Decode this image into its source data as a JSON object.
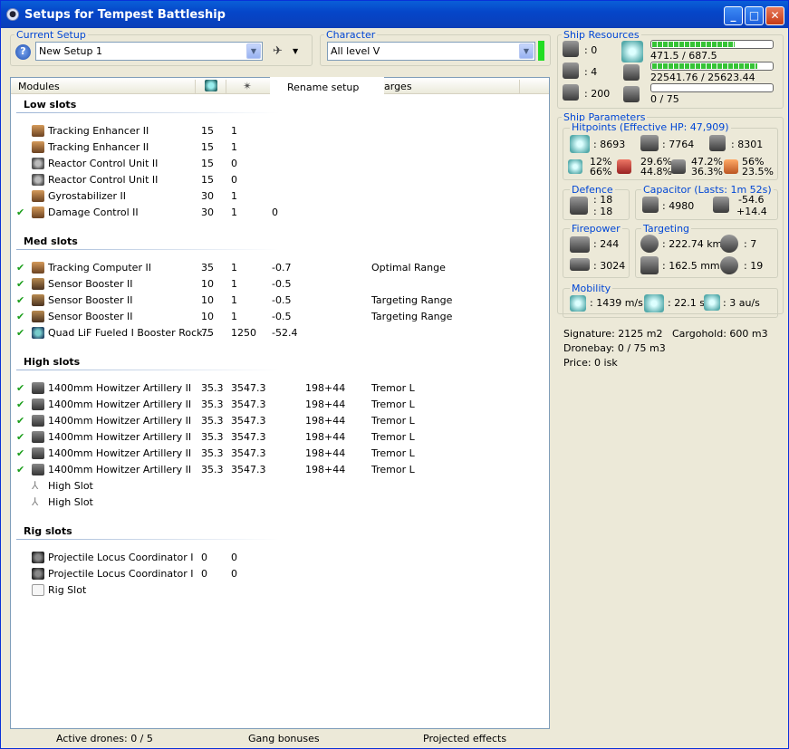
{
  "window": {
    "title": "Setups for Tempest Battleship",
    "icon": "eve-icon"
  },
  "current_setup": {
    "label": "Current Setup",
    "value": "New Setup 1"
  },
  "character": {
    "label": "Character",
    "value": "All level V",
    "status_color": "#22dd22"
  },
  "popup": {
    "rename": "Rename setup"
  },
  "columns": {
    "modules": "Modules",
    "charges": "arges"
  },
  "sections": {
    "low": "Low slots",
    "med": "Med slots",
    "high": "High slots",
    "rig": "Rig slots"
  },
  "low_slots": [
    {
      "check": "",
      "icon": "hardwiring",
      "name": "Tracking Enhancer II",
      "cpu": "15",
      "pg": "1",
      "c3": "",
      "c4": "",
      "c5": ""
    },
    {
      "check": "",
      "icon": "hardwiring",
      "name": "Tracking Enhancer II",
      "cpu": "15",
      "pg": "1",
      "c3": "",
      "c4": "",
      "c5": ""
    },
    {
      "check": "",
      "icon": "cpu",
      "name": "Reactor Control Unit II",
      "cpu": "15",
      "pg": "0",
      "c3": "",
      "c4": "",
      "c5": ""
    },
    {
      "check": "",
      "icon": "cpu",
      "name": "Reactor Control Unit II",
      "cpu": "15",
      "pg": "0",
      "c3": "",
      "c4": "",
      "c5": ""
    },
    {
      "check": "",
      "icon": "hardwiring",
      "name": "Gyrostabilizer II",
      "cpu": "30",
      "pg": "1",
      "c3": "",
      "c4": "",
      "c5": ""
    },
    {
      "check": "✔",
      "icon": "damage",
      "name": "Damage Control II",
      "cpu": "30",
      "pg": "1",
      "c3": "0",
      "c4": "",
      "c5": ""
    }
  ],
  "med_slots": [
    {
      "check": "✔",
      "icon": "hardwiring",
      "name": "Tracking Computer II",
      "cpu": "35",
      "pg": "1",
      "c3": "-0.7",
      "c4": "",
      "c5": "Optimal Range"
    },
    {
      "check": "✔",
      "icon": "sensor",
      "name": "Sensor Booster II",
      "cpu": "10",
      "pg": "1",
      "c3": "-0.5",
      "c4": "",
      "c5": ""
    },
    {
      "check": "✔",
      "icon": "sensor",
      "name": "Sensor Booster II",
      "cpu": "10",
      "pg": "1",
      "c3": "-0.5",
      "c4": "",
      "c5": "Targeting Range"
    },
    {
      "check": "✔",
      "icon": "sensor",
      "name": "Sensor Booster II",
      "cpu": "10",
      "pg": "1",
      "c3": "-0.5",
      "c4": "",
      "c5": "Targeting Range"
    },
    {
      "check": "✔",
      "icon": "booster",
      "name": "Quad LiF Fueled I Booster Rock...",
      "cpu": "75",
      "pg": "1250",
      "c3": "-52.4",
      "c4": "",
      "c5": ""
    }
  ],
  "high_slots": [
    {
      "check": "✔",
      "icon": "gun",
      "name": "1400mm Howitzer Artillery II",
      "cpu": "35.3",
      "pg": "3547.3",
      "c3": "",
      "c4": "198+44",
      "c5": "Tremor L"
    },
    {
      "check": "✔",
      "icon": "gun",
      "name": "1400mm Howitzer Artillery II",
      "cpu": "35.3",
      "pg": "3547.3",
      "c3": "",
      "c4": "198+44",
      "c5": "Tremor L"
    },
    {
      "check": "✔",
      "icon": "gun",
      "name": "1400mm Howitzer Artillery II",
      "cpu": "35.3",
      "pg": "3547.3",
      "c3": "",
      "c4": "198+44",
      "c5": "Tremor L"
    },
    {
      "check": "✔",
      "icon": "gun",
      "name": "1400mm Howitzer Artillery II",
      "cpu": "35.3",
      "pg": "3547.3",
      "c3": "",
      "c4": "198+44",
      "c5": "Tremor L"
    },
    {
      "check": "✔",
      "icon": "gun",
      "name": "1400mm Howitzer Artillery II",
      "cpu": "35.3",
      "pg": "3547.3",
      "c3": "",
      "c4": "198+44",
      "c5": "Tremor L"
    },
    {
      "check": "✔",
      "icon": "gun",
      "name": "1400mm Howitzer Artillery II",
      "cpu": "35.3",
      "pg": "3547.3",
      "c3": "",
      "c4": "198+44",
      "c5": "Tremor L"
    },
    {
      "check": "",
      "icon": "slot",
      "name": "High Slot",
      "cpu": "",
      "pg": "",
      "c3": "",
      "c4": "",
      "c5": ""
    },
    {
      "check": "",
      "icon": "slot",
      "name": "High Slot",
      "cpu": "",
      "pg": "",
      "c3": "",
      "c4": "",
      "c5": ""
    }
  ],
  "rig_slots": [
    {
      "check": "",
      "icon": "rig",
      "name": "Projectile Locus Coordinator I",
      "cpu": "0",
      "pg": "0",
      "c3": "",
      "c4": "",
      "c5": ""
    },
    {
      "check": "",
      "icon": "rig",
      "name": "Projectile Locus Coordinator I",
      "cpu": "0",
      "pg": "0",
      "c3": "",
      "c4": "",
      "c5": ""
    },
    {
      "check": "",
      "icon": "rigslot",
      "name": "Rig Slot",
      "cpu": "",
      "pg": "",
      "c3": "",
      "c4": "",
      "c5": ""
    }
  ],
  "status": {
    "drones": "Active drones: 0 / 5",
    "gang": "Gang bonuses",
    "projected": "Projected effects"
  },
  "resources": {
    "label": "Ship Resources",
    "turrets": ": 0",
    "launchers": ": 4",
    "calibration": ": 200",
    "cpu": "471.5 / 687.5",
    "cpu_fill": 0.686,
    "pg": "22541.76 / 25623.44",
    "pg_fill": 0.88,
    "drone": "0 / 75",
    "drone_fill": 0
  },
  "params": {
    "label": "Ship Parameters",
    "hp_label": "Hitpoints (Effective HP: 47,909)",
    "shield": ": 8693",
    "armor": ": 7764",
    "structure": ": 8301",
    "res_em": "12%\n66%",
    "res_th": "29.6%\n44.8%",
    "res_ki": "47.2%\n36.3%",
    "res_ex": "56%\n23.5%",
    "def_label": "Defence",
    "def1": ": 18",
    "def2": ": 18",
    "cap_label": "Capacitor (Lasts: 1m 52s)",
    "cap": ": 4980",
    "cap_d1": "-54.6",
    "cap_d2": "+14.4",
    "fp_label": "Firepower",
    "fp1": ": 244",
    "fp2": ": 3024",
    "tg_label": "Targeting",
    "tg_range": ": 222.74 km",
    "tg_max": ": 7",
    "tg_scan": ": 162.5 mm",
    "tg_res": ": 19",
    "mob_label": "Mobility",
    "speed": ": 1439 m/s",
    "align": ": 22.1 s",
    "warp": ": 3 au/s",
    "signature": "Signature: 2125 m2",
    "cargo": "Cargohold: 600 m3",
    "dronebay": "Dronebay: 0 / 75 m3",
    "price": "Price: 0 isk"
  }
}
